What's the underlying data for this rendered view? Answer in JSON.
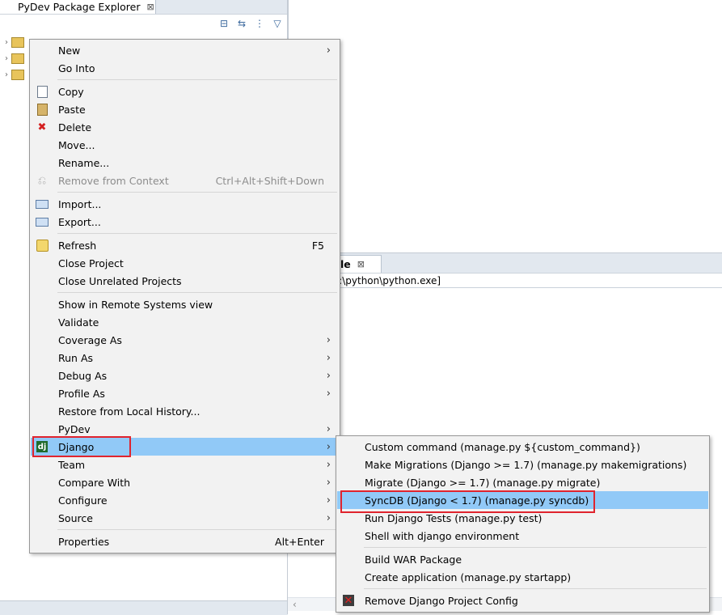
{
  "explorer": {
    "title": "PyDev Package Explorer",
    "close": "⊠"
  },
  "console": {
    "tab_label": "le",
    "tab_close": "⊠",
    "description": "y [E:\\python\\python.exe]"
  },
  "context_menu": {
    "items": [
      {
        "label": "New",
        "submenu": "›"
      },
      {
        "label": "Go Into"
      },
      {
        "label": "Copy",
        "icon": "copy-icon"
      },
      {
        "label": "Paste",
        "icon": "paste-icon"
      },
      {
        "label": "Delete",
        "icon": "delete-icon"
      },
      {
        "label": "Move..."
      },
      {
        "label": "Rename..."
      },
      {
        "label": "Remove from Context",
        "accel": "Ctrl+Alt+Shift+Down",
        "icon": "remove-context-icon",
        "disabled": true
      },
      {
        "label": "Import...",
        "icon": "import-icon"
      },
      {
        "label": "Export...",
        "icon": "export-icon"
      },
      {
        "label": "Refresh",
        "accel": "F5",
        "icon": "refresh-icon"
      },
      {
        "label": "Close Project"
      },
      {
        "label": "Close Unrelated Projects"
      },
      {
        "label": "Show in Remote Systems view"
      },
      {
        "label": "Validate"
      },
      {
        "label": "Coverage As",
        "submenu": "›"
      },
      {
        "label": "Run As",
        "submenu": "›"
      },
      {
        "label": "Debug As",
        "submenu": "›"
      },
      {
        "label": "Profile As",
        "submenu": "›"
      },
      {
        "label": "Restore from Local History..."
      },
      {
        "label": "PyDev",
        "submenu": "›"
      },
      {
        "label": "Django",
        "submenu": "›",
        "icon": "django-icon",
        "glyph": "dj",
        "highlighted": true
      },
      {
        "label": "Team",
        "submenu": "›"
      },
      {
        "label": "Compare With",
        "submenu": "›"
      },
      {
        "label": "Configure",
        "submenu": "›"
      },
      {
        "label": "Source",
        "submenu": "›"
      },
      {
        "label": "Properties",
        "accel": "Alt+Enter"
      }
    ]
  },
  "django_submenu": {
    "items": [
      {
        "label": "Custom command (manage.py ${custom_command})"
      },
      {
        "label": "Make Migrations (Django >= 1.7) (manage.py makemigrations)"
      },
      {
        "label": "Migrate (Django >= 1.7) (manage.py migrate)"
      },
      {
        "label": "SyncDB (Django < 1.7) (manage.py syncdb)",
        "highlighted": true
      },
      {
        "label": "Run Django Tests (manage.py test)"
      },
      {
        "label": "Shell with django environment"
      },
      {
        "label": "Build WAR Package"
      },
      {
        "label": "Create application (manage.py startapp)"
      },
      {
        "label": "Remove Django Project Config",
        "icon": "remove-config-icon",
        "glyph": "✕"
      }
    ]
  },
  "colors": {
    "highlight": "#91c9f7",
    "annotation_red": "#e0242e"
  }
}
